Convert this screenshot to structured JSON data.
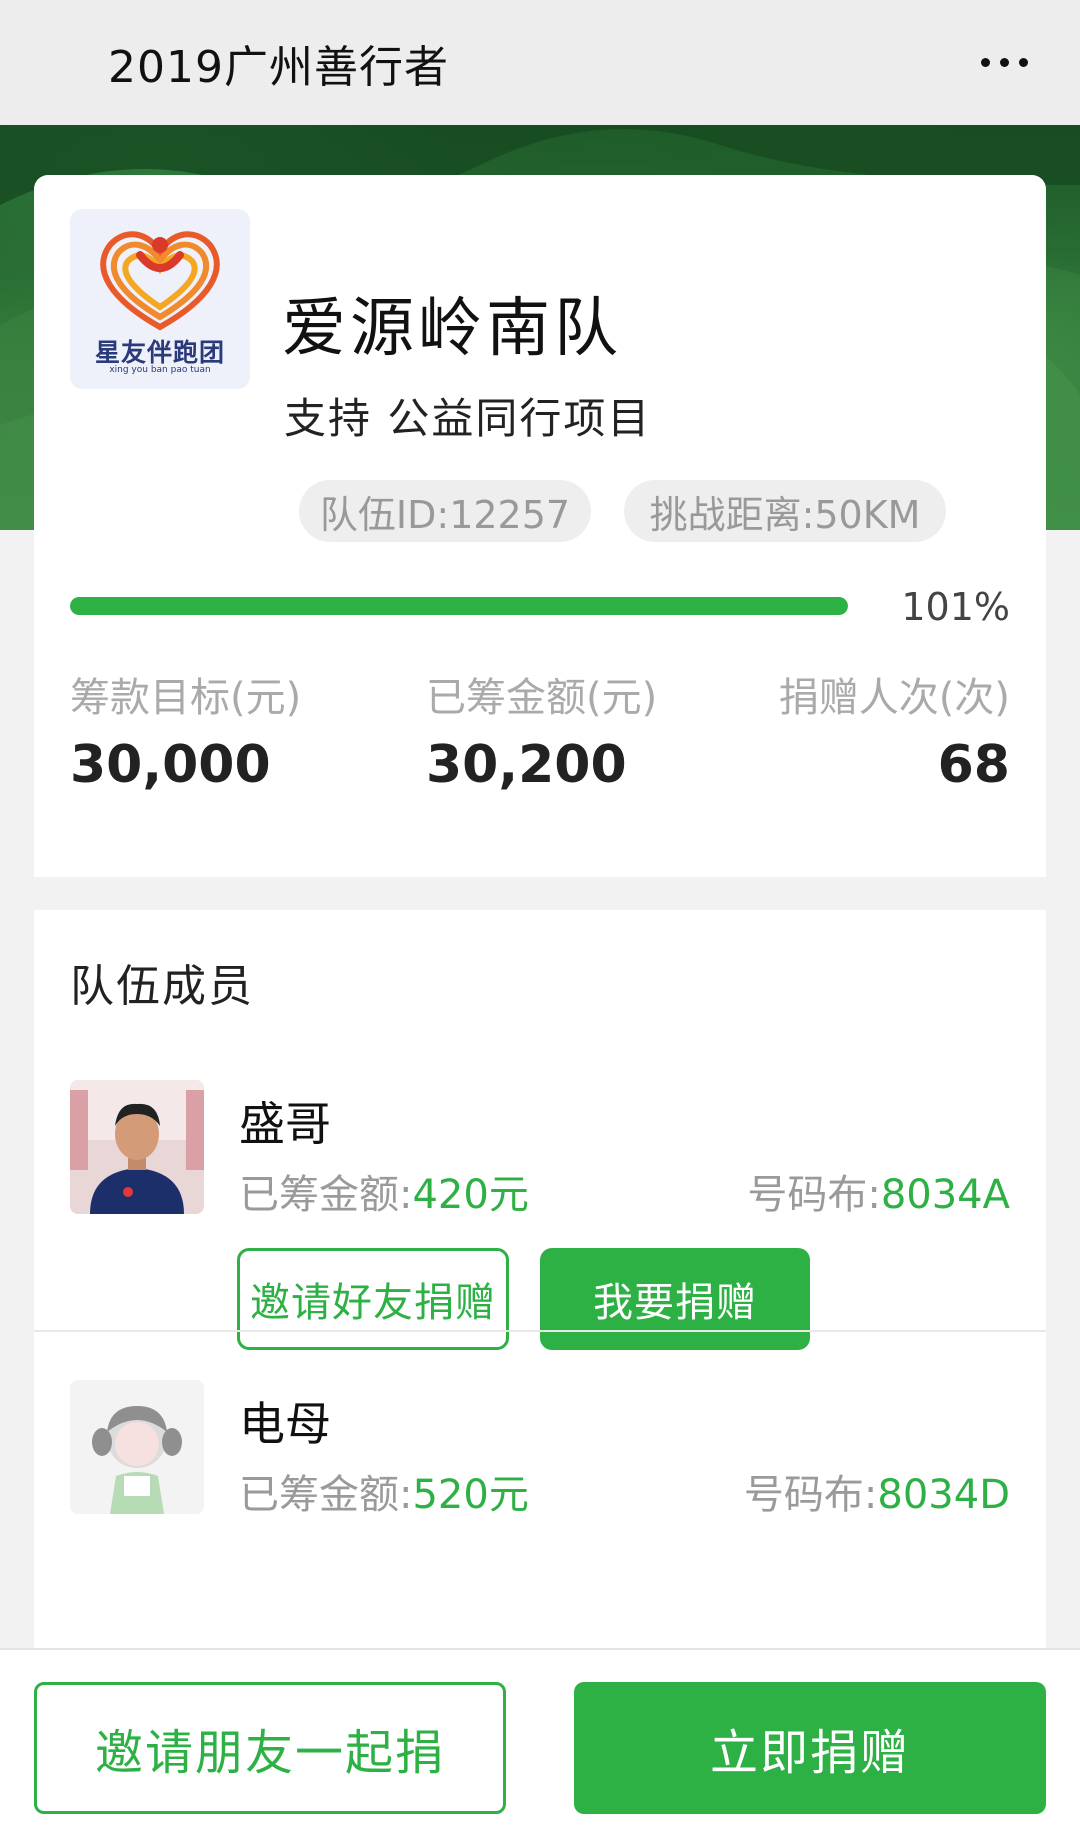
{
  "topbar": {
    "title": "2019广州善行者",
    "more_icon": "more-dots-icon"
  },
  "team": {
    "name": "爱源岭南队",
    "support": "支持 公益同行项目",
    "logo_text": "星友伴跑团",
    "logo_subtext": "xing you ban pao tuan",
    "team_id": "队伍ID:12257",
    "distance": "挑战距离:50KM",
    "progress_fraction": 1.01,
    "progress_label": "101%",
    "stats": {
      "goal_label": "筹款目标(元)",
      "goal_value": "30,000",
      "raised_label": "已筹金额(元)",
      "raised_value": "30,200",
      "donors_label": "捐赠人次(次)",
      "donors_value": "68"
    }
  },
  "members": {
    "title": "队伍成员",
    "list": [
      {
        "name": "盛哥",
        "raised_prefix": "已筹金额:",
        "raised_amount": "420元",
        "bib_prefix": "号码布:",
        "bib": "8034A",
        "invite_label": "邀请好友捐赠",
        "donate_label": "我要捐赠"
      },
      {
        "name": "电母",
        "raised_prefix": "已筹金额:",
        "raised_amount": "520元",
        "bib_prefix": "号码布:",
        "bib": "8034D"
      }
    ]
  },
  "bottom": {
    "invite_label": "邀请朋友一起捐",
    "donate_label": "立即捐赠"
  },
  "colors": {
    "accent": "#2db044",
    "banner": "#2d7336",
    "page_bg": "#f2f2f2"
  }
}
